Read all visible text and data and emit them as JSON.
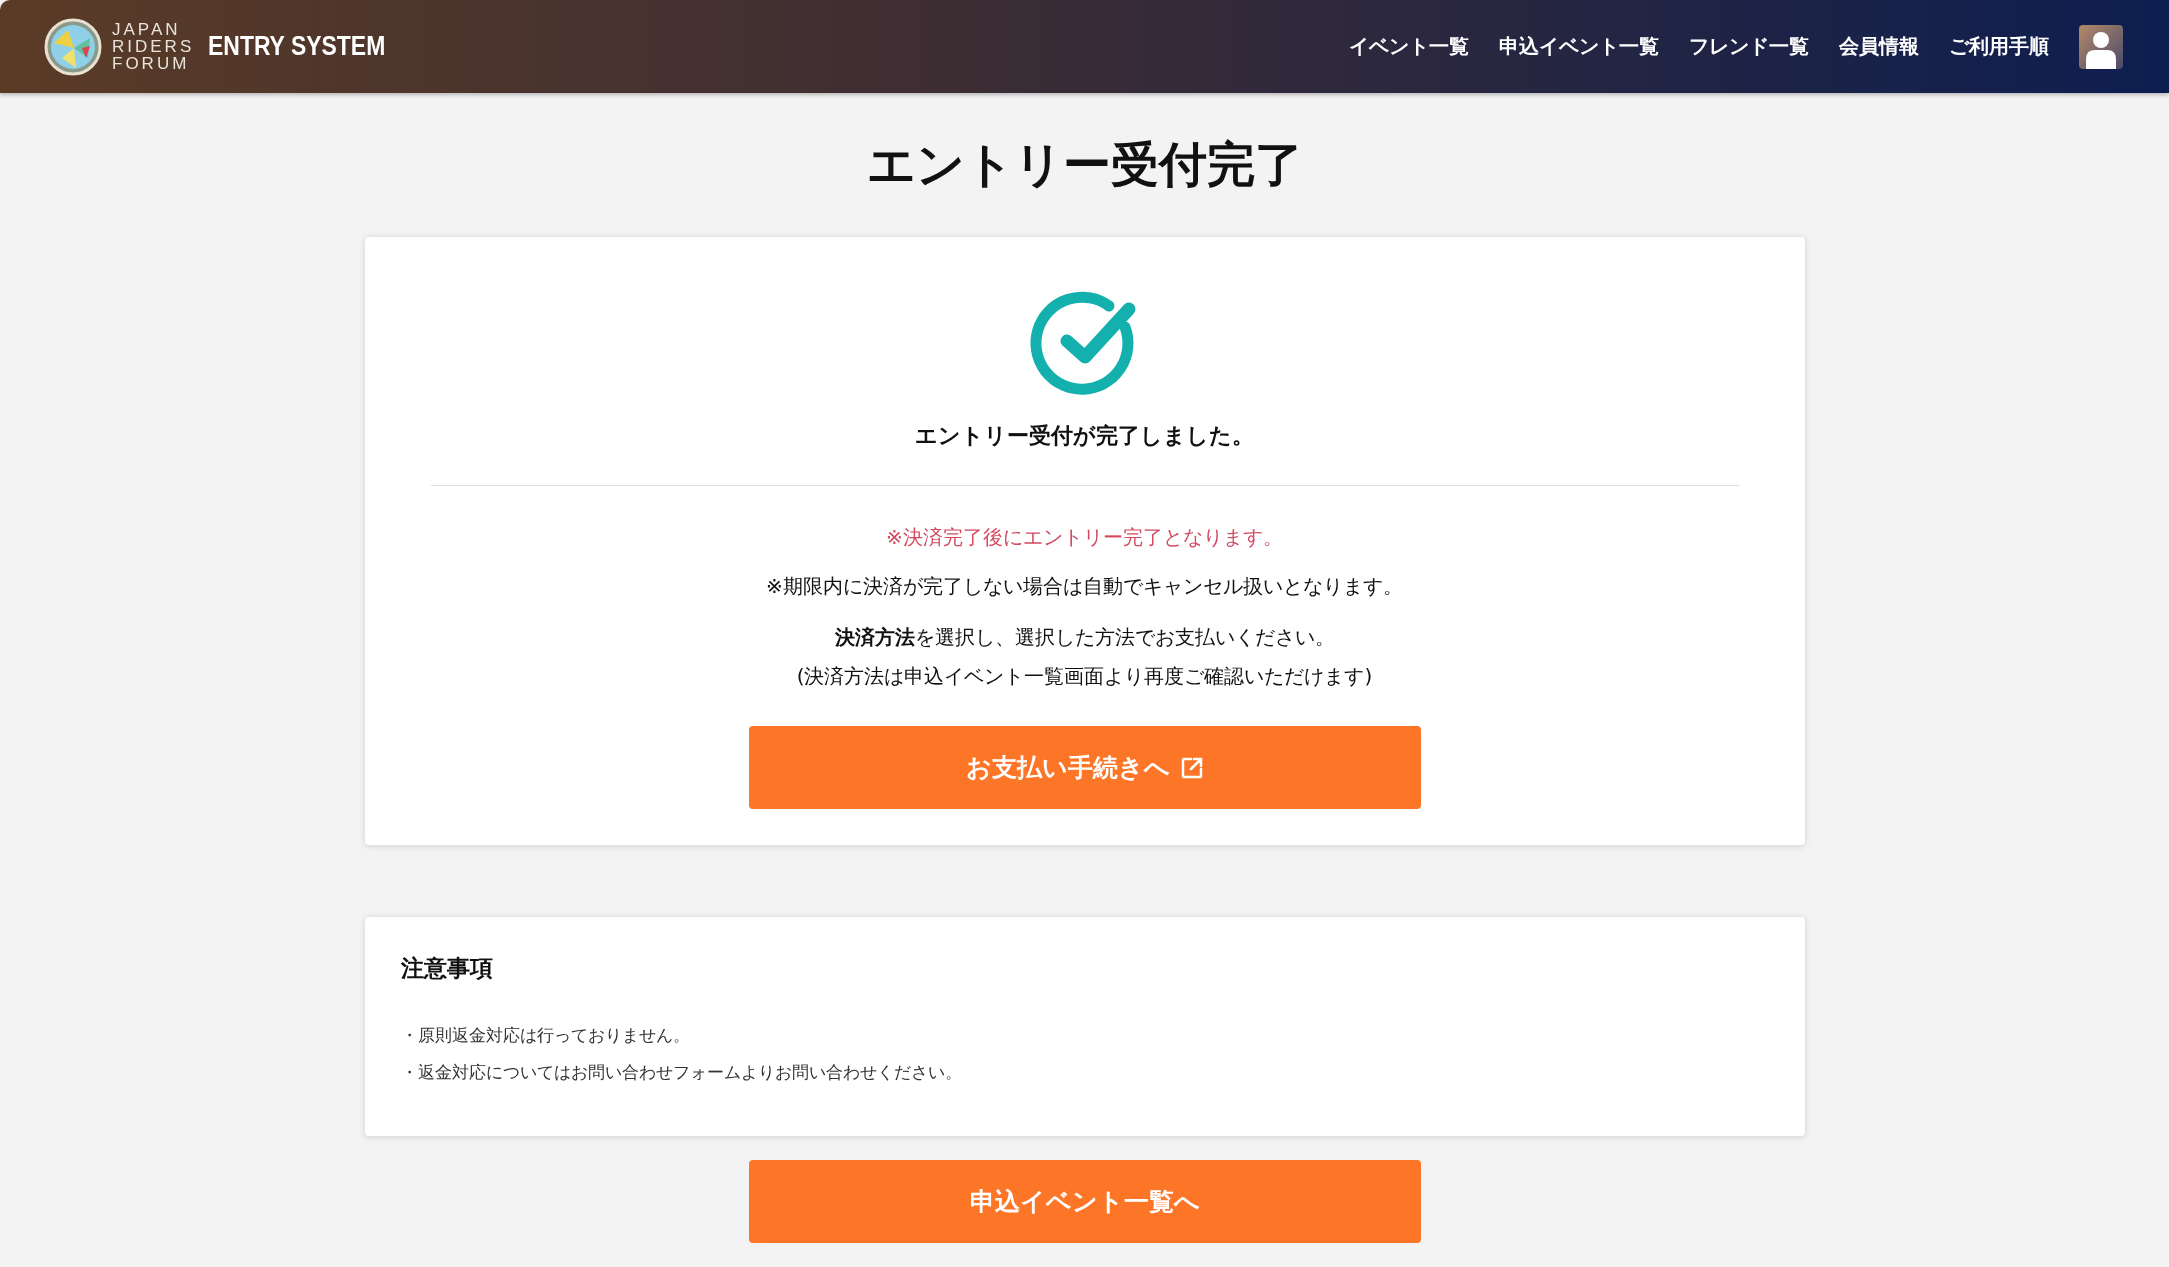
{
  "header": {
    "logo_lines": [
      "JAPAN",
      "RIDERS",
      "FORUM"
    ],
    "system_name": "ENTRY SYSTEM",
    "nav": [
      "イベント一覧",
      "申込イベント一覧",
      "フレンド一覧",
      "会員情報",
      "ご利用手順"
    ]
  },
  "page_title": "エントリー受付完了",
  "result_card": {
    "message": "エントリー受付が完了しました。",
    "warning": "※決済完了後にエントリー完了となります。",
    "notes": [
      "※期限内に決済が完了しない場合は自動でキャンセル扱いとなります。",
      "**決済方法**を選択し、選択した方法でお支払いください。",
      "(決済方法は申込イベント一覧画面より再度ご確認いただけます)"
    ],
    "pay_button": "お支払い手続きへ"
  },
  "notice_card": {
    "title": "注意事項",
    "items": [
      "・原則返金対応は行っておりません。",
      "・返金対応についてはお問い合わせフォームよりお問い合わせください。"
    ]
  },
  "back_button": "申込イベント一覧へ"
}
